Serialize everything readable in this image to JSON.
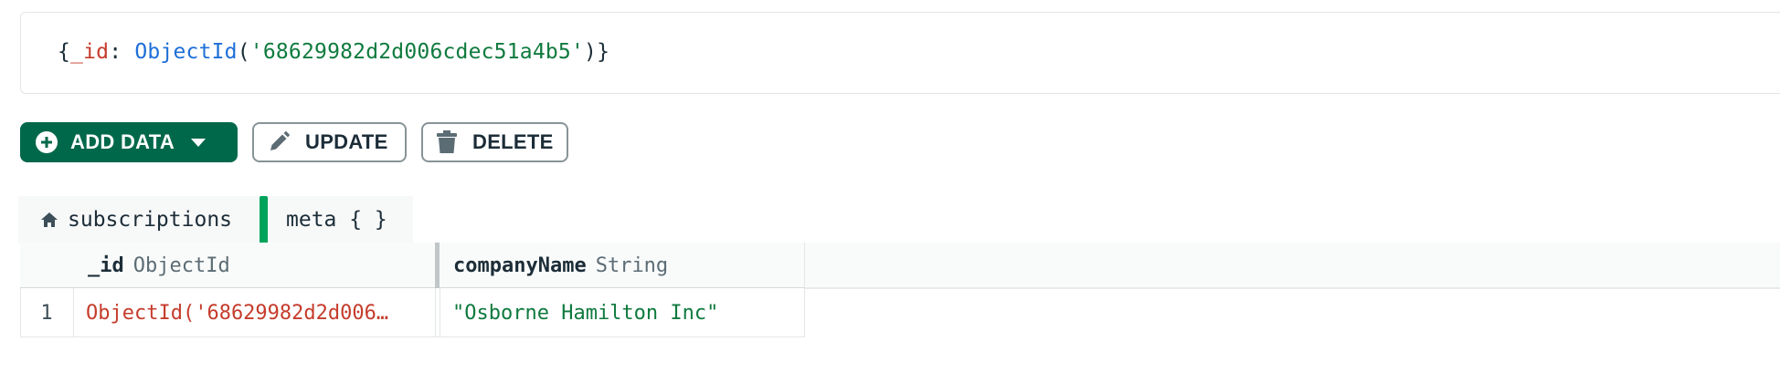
{
  "query": {
    "open_brace": "{",
    "key": "_id",
    "colon": ": ",
    "func": "ObjectId",
    "open_paren": "(",
    "value": "'68629982d2d006cdec51a4b5'",
    "close": ")}"
  },
  "toolbar": {
    "add_data_label": "ADD DATA",
    "update_label": "UPDATE",
    "delete_label": "DELETE"
  },
  "tabs": [
    {
      "label": "subscriptions",
      "icon": "home-icon"
    },
    {
      "label": "meta { }"
    }
  ],
  "grid": {
    "columns": [
      {
        "name": "_id",
        "type": "ObjectId"
      },
      {
        "name": "companyName",
        "type": "String"
      }
    ],
    "rows": [
      {
        "index": "1",
        "_id": "ObjectId('68629982d2d006…",
        "companyName": "\"Osborne Hamilton Inc\""
      }
    ]
  },
  "colors": {
    "primary_button": "#00684a",
    "tab_accent": "#00a35c",
    "objectid_text": "#c53c2c",
    "string_text": "#0f7a3e"
  }
}
